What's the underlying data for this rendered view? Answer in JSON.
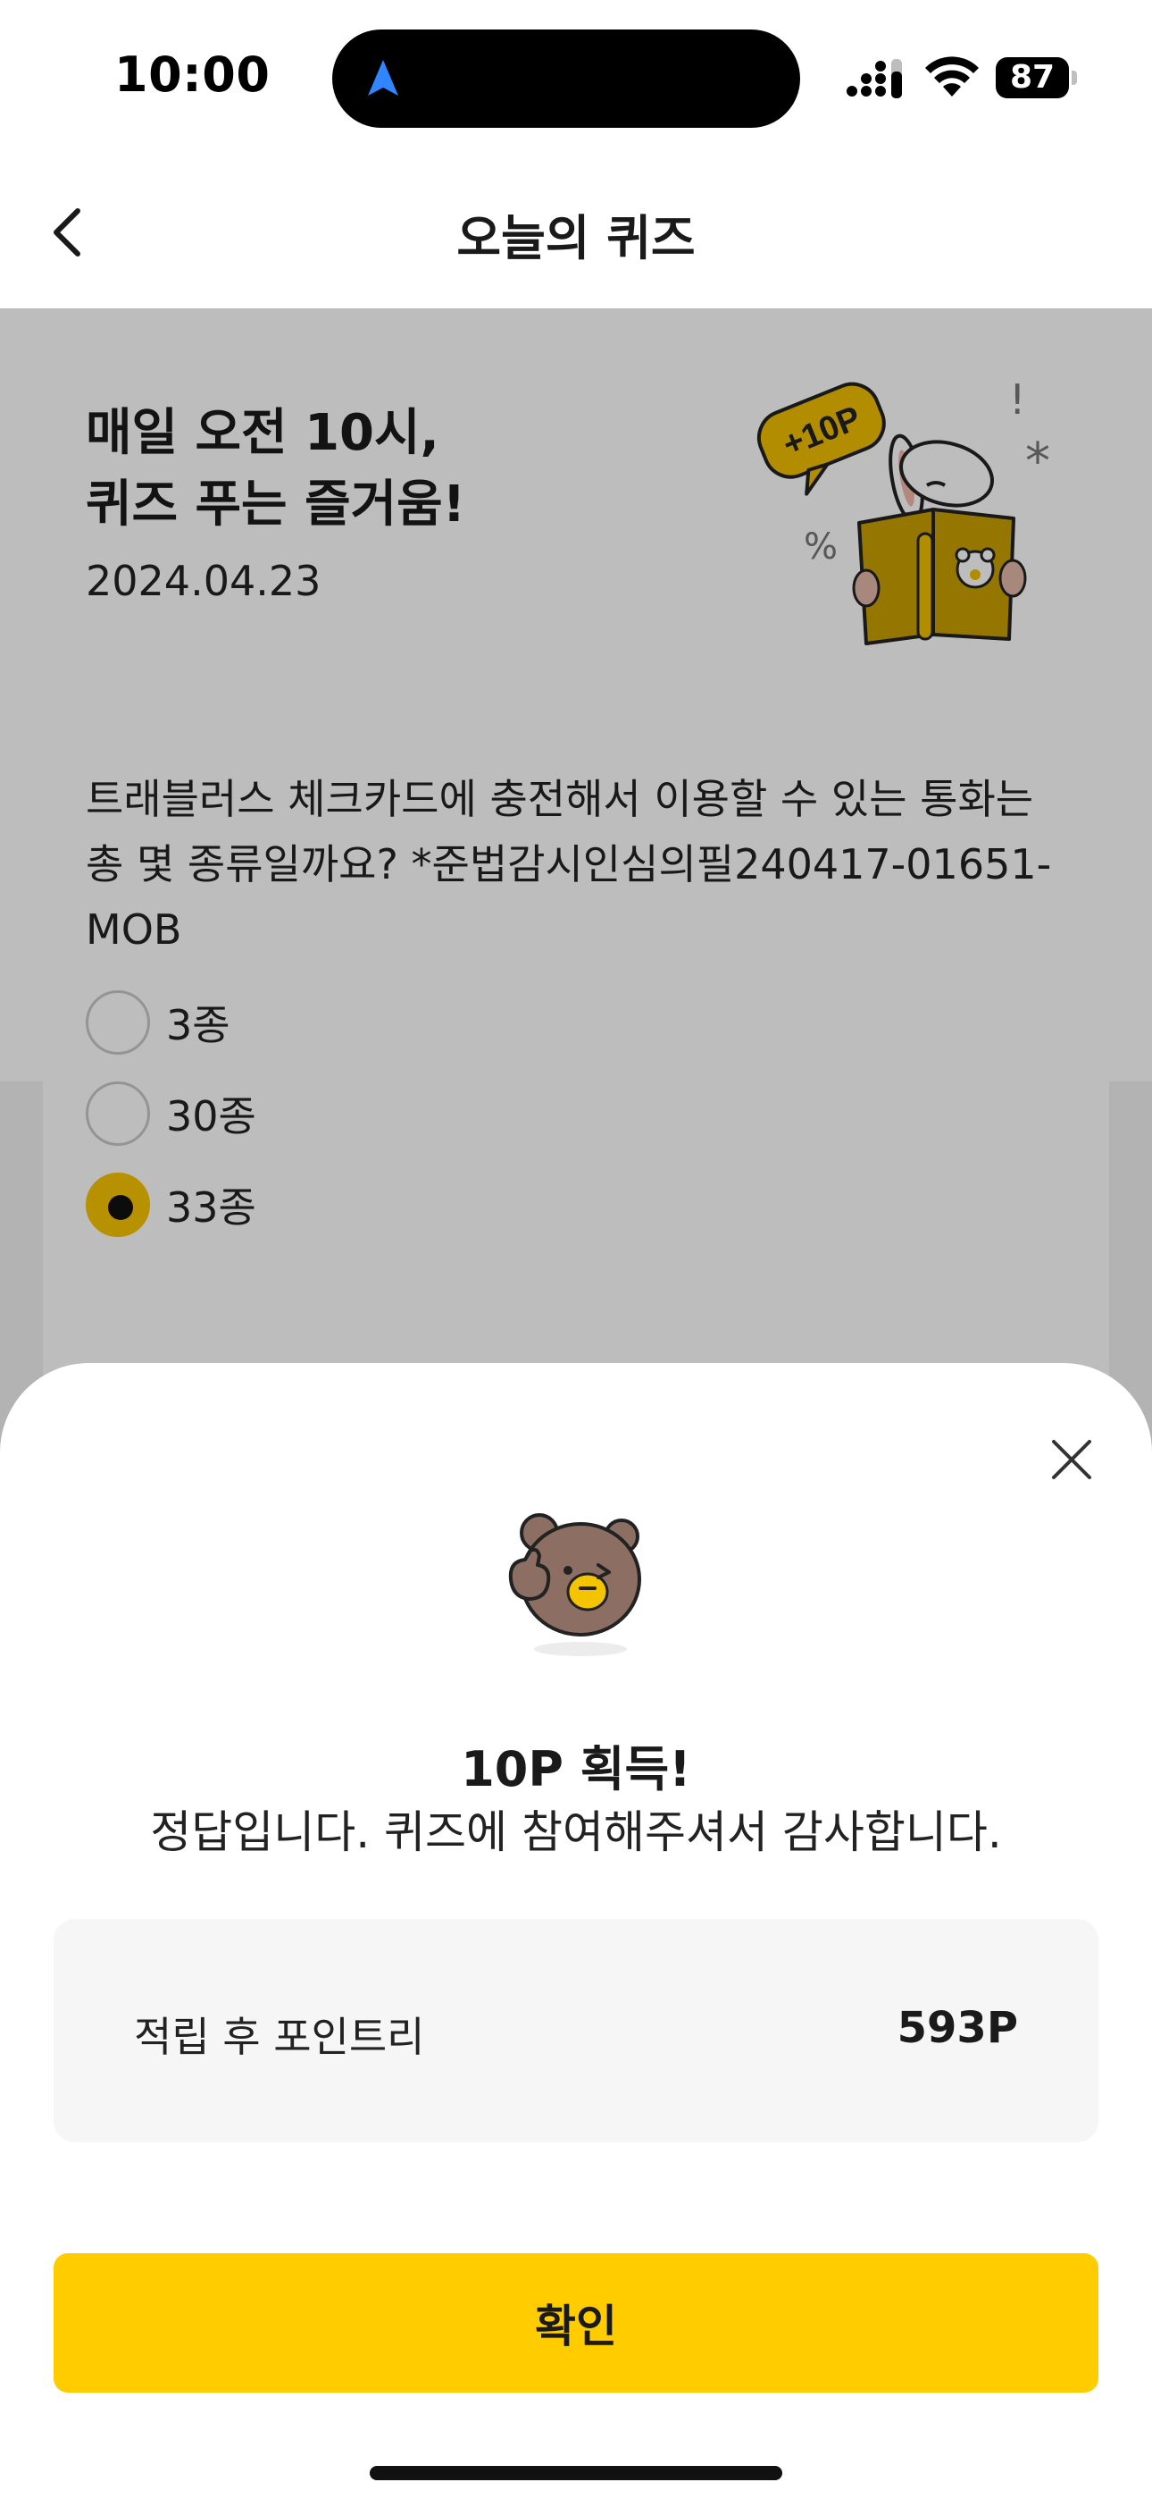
{
  "status_bar": {
    "time": "10:00",
    "battery": "87"
  },
  "header": {
    "title": "오늘의 퀴즈"
  },
  "banner": {
    "title_line1": "매일 오전 10시,",
    "title_line2": "퀴즈 푸는 즐거움!",
    "date": "2024.04.23",
    "illustration_badge": "+10P"
  },
  "quiz": {
    "question": "트래블러스 체크카드에 충전해서 이용할 수 있는 통화는 총 몇 종류일까요? *준법감시인심의필240417-01651-MOB",
    "options": [
      {
        "label": "3종",
        "selected": false
      },
      {
        "label": "30종",
        "selected": false
      },
      {
        "label": "33종",
        "selected": true
      }
    ]
  },
  "result_sheet": {
    "title": "10P 획득!",
    "message": "정답입니다. 퀴즈에 참여해주셔서 감사합니다.",
    "points_label": "적립 후 포인트리",
    "points_value": "593P",
    "confirm_label": "확인"
  },
  "colors": {
    "accent": "#FFCC00",
    "selected_radio": "#F7C400",
    "dim": "rgba(0,0,0,0.26)"
  }
}
